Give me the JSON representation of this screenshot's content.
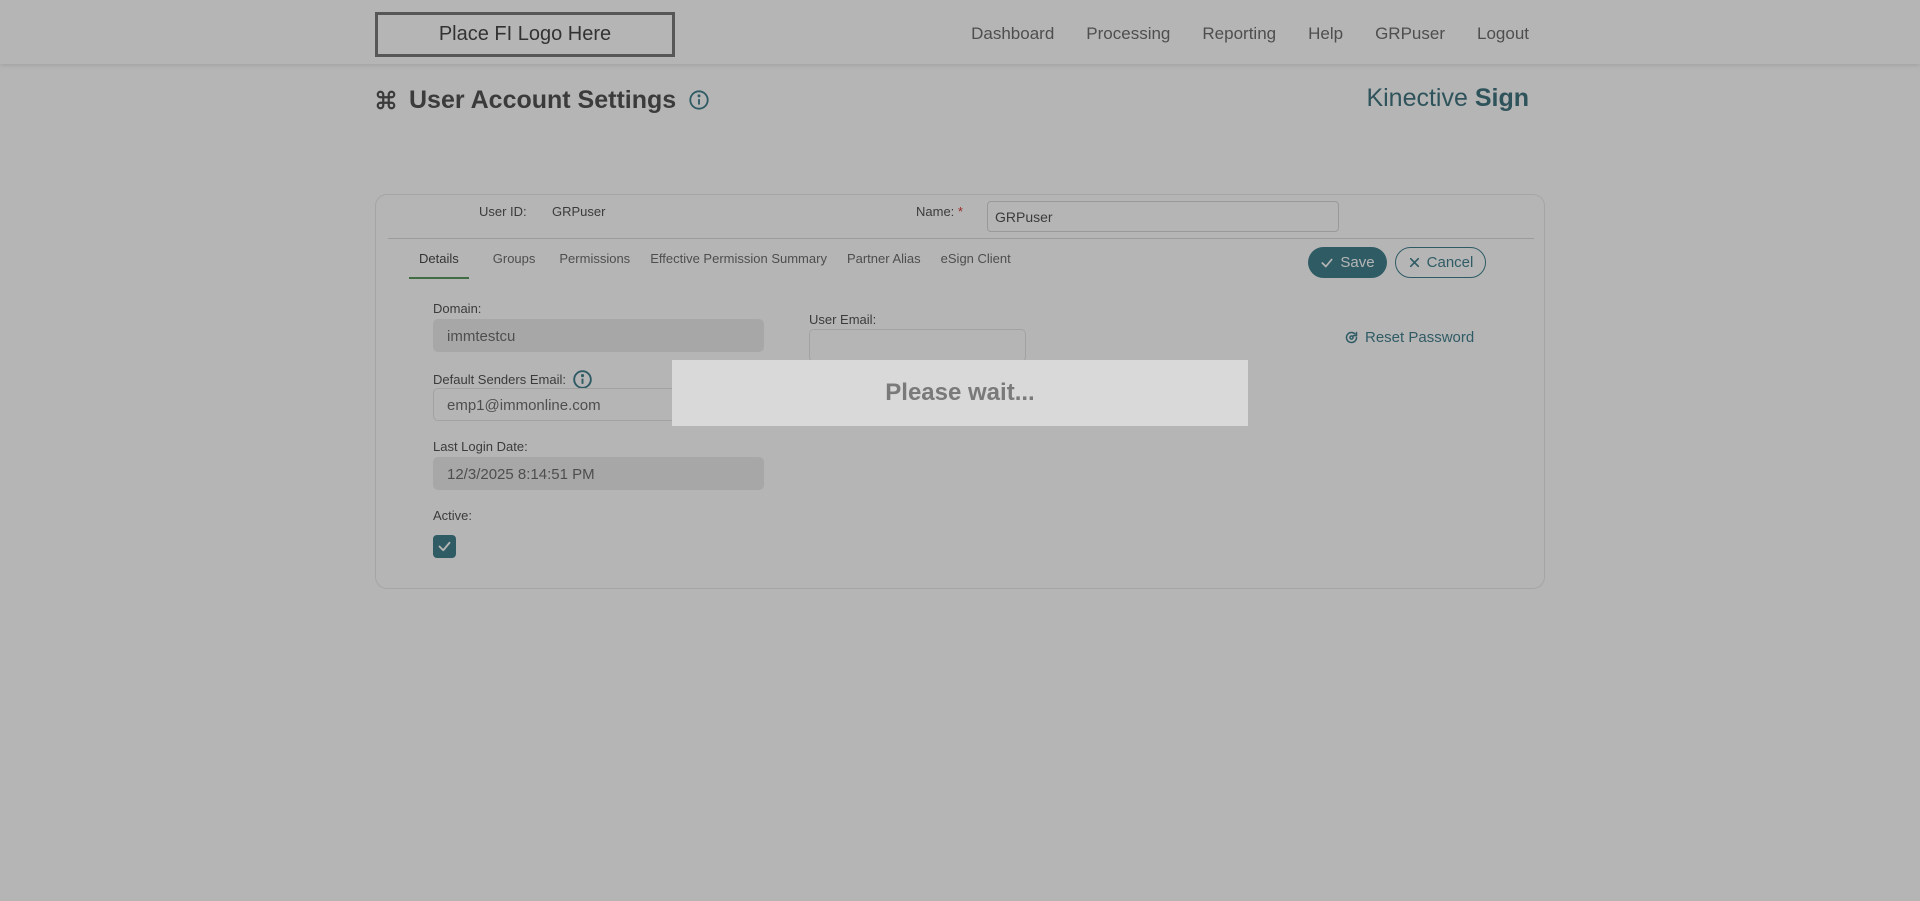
{
  "header": {
    "logo_text": "Place FI Logo Here",
    "nav": [
      "Dashboard",
      "Processing",
      "Reporting",
      "Help",
      "GRPuser",
      "Logout"
    ]
  },
  "page": {
    "title": "User Account Settings",
    "brand_light": "Kinective ",
    "brand_bold": "Sign"
  },
  "user": {
    "user_id_label": "User ID:",
    "user_id_value": "GRPuser",
    "name_label": "Name:",
    "name_required": "*",
    "name_value": "GRPuser"
  },
  "tabs": [
    "Details",
    "Groups",
    "Permissions",
    "Effective Permission Summary",
    "Partner Alias",
    "eSign Client"
  ],
  "active_tab": "Details",
  "actions": {
    "save_label": "Save",
    "cancel_label": "Cancel",
    "reset_password_label": "Reset Password"
  },
  "details": {
    "domain_label": "Domain:",
    "domain_value": "immtestcu",
    "default_senders_email_label": "Default Senders Email:",
    "default_senders_email_value": "emp1@immonline.com",
    "last_login_label": "Last Login Date:",
    "last_login_value": "12/3/2025 8:14:51 PM",
    "active_label": "Active:",
    "active_checked": true,
    "user_email_label": "User Email:",
    "user_email_value": ""
  },
  "overlay": {
    "message": "Please wait..."
  },
  "colors": {
    "accent": "#0c5c6e",
    "active_tab_underline": "#2e7d32",
    "required": "#cc0000"
  }
}
